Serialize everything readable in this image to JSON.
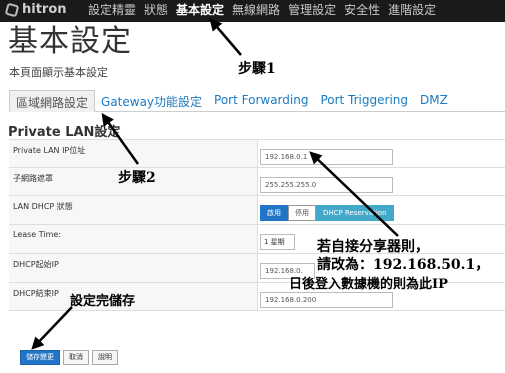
{
  "logo": "hitron",
  "nav": [
    "設定精靈",
    "狀態",
    "基本設定",
    "無線網路",
    "管理設定",
    "安全性",
    "進階設定"
  ],
  "page_title": "基本設定",
  "page_subtitle": "本頁面顯示基本設定",
  "tabs": [
    "區域網路設定",
    "Gateway功能設定",
    "Port Forwarding",
    "Port Triggering",
    "DMZ"
  ],
  "section_title": "Private LAN設定",
  "form": {
    "private_ip_label": "Private LAN IP位址",
    "private_ip_value": "192.168.0.1",
    "subnet_label": "子網路遮罩",
    "subnet_value": "255.255.255.0",
    "dhcp_label": "LAN DHCP 狀態",
    "dhcp_enable": "啟用",
    "dhcp_disable": "停用",
    "dhcp_reservation": "DHCP Reservation",
    "lease_label": "Lease Time:",
    "lease_value": "1 星期",
    "dhcp_start_label": "DHCP起始IP",
    "dhcp_start_value": "192.168.0.",
    "dhcp_end_label": "DHCP結束IP",
    "dhcp_end_value": "192.168.0.200"
  },
  "buttons": {
    "save": "儲存變更",
    "cancel": "取消",
    "help": "說明"
  },
  "annotations": {
    "step1": "步驟1",
    "step2": "步驟2",
    "save_note": "設定完儲存",
    "note_line1": "若自接分享器則，",
    "note_line2": "請改為：192.168.50.1，",
    "note_line3": "日後登入數據機的則為此IP"
  }
}
